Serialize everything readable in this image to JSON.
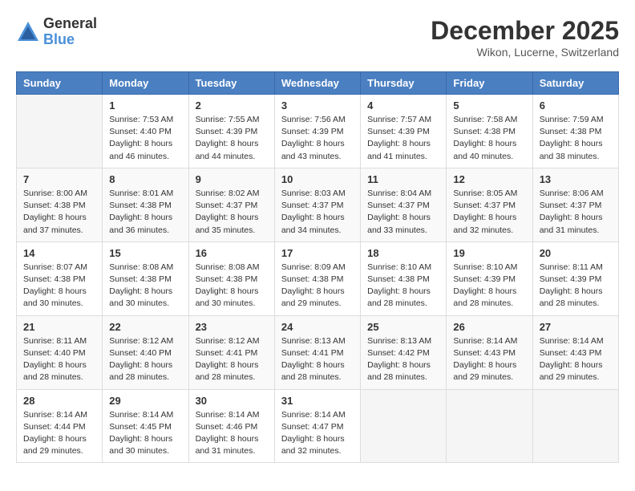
{
  "header": {
    "logo_general": "General",
    "logo_blue": "Blue",
    "month_title": "December 2025",
    "location": "Wikon, Lucerne, Switzerland"
  },
  "weekdays": [
    "Sunday",
    "Monday",
    "Tuesday",
    "Wednesday",
    "Thursday",
    "Friday",
    "Saturday"
  ],
  "weeks": [
    [
      {
        "day": "",
        "sunrise": "",
        "sunset": "",
        "daylight": ""
      },
      {
        "day": "1",
        "sunrise": "Sunrise: 7:53 AM",
        "sunset": "Sunset: 4:40 PM",
        "daylight": "Daylight: 8 hours and 46 minutes."
      },
      {
        "day": "2",
        "sunrise": "Sunrise: 7:55 AM",
        "sunset": "Sunset: 4:39 PM",
        "daylight": "Daylight: 8 hours and 44 minutes."
      },
      {
        "day": "3",
        "sunrise": "Sunrise: 7:56 AM",
        "sunset": "Sunset: 4:39 PM",
        "daylight": "Daylight: 8 hours and 43 minutes."
      },
      {
        "day": "4",
        "sunrise": "Sunrise: 7:57 AM",
        "sunset": "Sunset: 4:39 PM",
        "daylight": "Daylight: 8 hours and 41 minutes."
      },
      {
        "day": "5",
        "sunrise": "Sunrise: 7:58 AM",
        "sunset": "Sunset: 4:38 PM",
        "daylight": "Daylight: 8 hours and 40 minutes."
      },
      {
        "day": "6",
        "sunrise": "Sunrise: 7:59 AM",
        "sunset": "Sunset: 4:38 PM",
        "daylight": "Daylight: 8 hours and 38 minutes."
      }
    ],
    [
      {
        "day": "7",
        "sunrise": "Sunrise: 8:00 AM",
        "sunset": "Sunset: 4:38 PM",
        "daylight": "Daylight: 8 hours and 37 minutes."
      },
      {
        "day": "8",
        "sunrise": "Sunrise: 8:01 AM",
        "sunset": "Sunset: 4:38 PM",
        "daylight": "Daylight: 8 hours and 36 minutes."
      },
      {
        "day": "9",
        "sunrise": "Sunrise: 8:02 AM",
        "sunset": "Sunset: 4:37 PM",
        "daylight": "Daylight: 8 hours and 35 minutes."
      },
      {
        "day": "10",
        "sunrise": "Sunrise: 8:03 AM",
        "sunset": "Sunset: 4:37 PM",
        "daylight": "Daylight: 8 hours and 34 minutes."
      },
      {
        "day": "11",
        "sunrise": "Sunrise: 8:04 AM",
        "sunset": "Sunset: 4:37 PM",
        "daylight": "Daylight: 8 hours and 33 minutes."
      },
      {
        "day": "12",
        "sunrise": "Sunrise: 8:05 AM",
        "sunset": "Sunset: 4:37 PM",
        "daylight": "Daylight: 8 hours and 32 minutes."
      },
      {
        "day": "13",
        "sunrise": "Sunrise: 8:06 AM",
        "sunset": "Sunset: 4:37 PM",
        "daylight": "Daylight: 8 hours and 31 minutes."
      }
    ],
    [
      {
        "day": "14",
        "sunrise": "Sunrise: 8:07 AM",
        "sunset": "Sunset: 4:38 PM",
        "daylight": "Daylight: 8 hours and 30 minutes."
      },
      {
        "day": "15",
        "sunrise": "Sunrise: 8:08 AM",
        "sunset": "Sunset: 4:38 PM",
        "daylight": "Daylight: 8 hours and 30 minutes."
      },
      {
        "day": "16",
        "sunrise": "Sunrise: 8:08 AM",
        "sunset": "Sunset: 4:38 PM",
        "daylight": "Daylight: 8 hours and 30 minutes."
      },
      {
        "day": "17",
        "sunrise": "Sunrise: 8:09 AM",
        "sunset": "Sunset: 4:38 PM",
        "daylight": "Daylight: 8 hours and 29 minutes."
      },
      {
        "day": "18",
        "sunrise": "Sunrise: 8:10 AM",
        "sunset": "Sunset: 4:38 PM",
        "daylight": "Daylight: 8 hours and 28 minutes."
      },
      {
        "day": "19",
        "sunrise": "Sunrise: 8:10 AM",
        "sunset": "Sunset: 4:39 PM",
        "daylight": "Daylight: 8 hours and 28 minutes."
      },
      {
        "day": "20",
        "sunrise": "Sunrise: 8:11 AM",
        "sunset": "Sunset: 4:39 PM",
        "daylight": "Daylight: 8 hours and 28 minutes."
      }
    ],
    [
      {
        "day": "21",
        "sunrise": "Sunrise: 8:11 AM",
        "sunset": "Sunset: 4:40 PM",
        "daylight": "Daylight: 8 hours and 28 minutes."
      },
      {
        "day": "22",
        "sunrise": "Sunrise: 8:12 AM",
        "sunset": "Sunset: 4:40 PM",
        "daylight": "Daylight: 8 hours and 28 minutes."
      },
      {
        "day": "23",
        "sunrise": "Sunrise: 8:12 AM",
        "sunset": "Sunset: 4:41 PM",
        "daylight": "Daylight: 8 hours and 28 minutes."
      },
      {
        "day": "24",
        "sunrise": "Sunrise: 8:13 AM",
        "sunset": "Sunset: 4:41 PM",
        "daylight": "Daylight: 8 hours and 28 minutes."
      },
      {
        "day": "25",
        "sunrise": "Sunrise: 8:13 AM",
        "sunset": "Sunset: 4:42 PM",
        "daylight": "Daylight: 8 hours and 28 minutes."
      },
      {
        "day": "26",
        "sunrise": "Sunrise: 8:14 AM",
        "sunset": "Sunset: 4:43 PM",
        "daylight": "Daylight: 8 hours and 29 minutes."
      },
      {
        "day": "27",
        "sunrise": "Sunrise: 8:14 AM",
        "sunset": "Sunset: 4:43 PM",
        "daylight": "Daylight: 8 hours and 29 minutes."
      }
    ],
    [
      {
        "day": "28",
        "sunrise": "Sunrise: 8:14 AM",
        "sunset": "Sunset: 4:44 PM",
        "daylight": "Daylight: 8 hours and 29 minutes."
      },
      {
        "day": "29",
        "sunrise": "Sunrise: 8:14 AM",
        "sunset": "Sunset: 4:45 PM",
        "daylight": "Daylight: 8 hours and 30 minutes."
      },
      {
        "day": "30",
        "sunrise": "Sunrise: 8:14 AM",
        "sunset": "Sunset: 4:46 PM",
        "daylight": "Daylight: 8 hours and 31 minutes."
      },
      {
        "day": "31",
        "sunrise": "Sunrise: 8:14 AM",
        "sunset": "Sunset: 4:47 PM",
        "daylight": "Daylight: 8 hours and 32 minutes."
      },
      {
        "day": "",
        "sunrise": "",
        "sunset": "",
        "daylight": ""
      },
      {
        "day": "",
        "sunrise": "",
        "sunset": "",
        "daylight": ""
      },
      {
        "day": "",
        "sunrise": "",
        "sunset": "",
        "daylight": ""
      }
    ]
  ]
}
